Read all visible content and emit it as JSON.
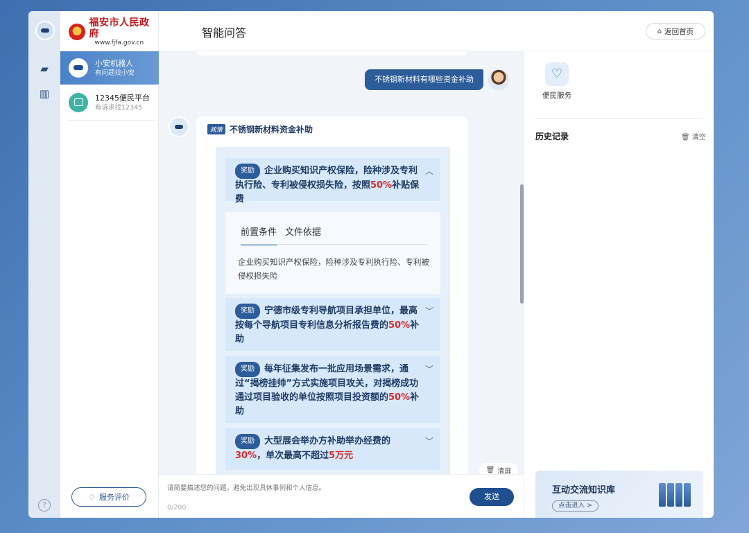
{
  "app": {
    "logo_cn": "福安市人民政府",
    "logo_url": "www.fjfa.gov.cn"
  },
  "sidebar": {
    "channels": [
      {
        "title": "小安机器人",
        "subtitle": "有问题找小安"
      },
      {
        "title": "12345便民平台",
        "subtitle": "有诉求找12345"
      }
    ],
    "rate_button": "服务评价",
    "help_symbol": "?"
  },
  "header": {
    "title": "智能问答",
    "home_button": "返回首页"
  },
  "chat": {
    "user_question": "不锈钢新材料有哪些资金补助",
    "answer_tag": "政策",
    "answer_title": "不锈钢新材料资金补助",
    "badge": "奖励",
    "items": [
      {
        "parts": [
          "企业购买知识产权保险，险种涉及专利执行险、专利被侵权损失险，按照",
          "50%",
          "补贴保费"
        ],
        "expanded": true
      },
      {
        "parts": [
          "宁德市级专利导航项目承担单位，最高按每个导航项目专利信息分析报告费的",
          "50%",
          "补助"
        ],
        "expanded": false
      },
      {
        "parts": [
          "每年征集发布一批应用场景需求，通过“揭榜挂帅”方式实施项目攻关，对揭榜成功通过项目验收的单位按照项目投资额的",
          "50%",
          "补助"
        ],
        "expanded": false
      },
      {
        "parts": [
          "大型展会举办方补助举办经费的",
          "30%",
          "，单次最高不超过",
          "5万元"
        ],
        "expanded": false
      }
    ],
    "detail_tabs": [
      "前置条件",
      "文件依据"
    ],
    "detail_body": "企业购买知识产权保险，险种涉及专利执行险、专利被侵权损失险",
    "clear_screen": "清屏"
  },
  "input": {
    "placeholder": "请简要描述您的问题，避免出现具体事例和个人信息。",
    "counter": "0/200",
    "send": "发送"
  },
  "right_panel": {
    "service_label": "便民服务",
    "history_title": "历史记录",
    "clear_label": "清空",
    "kb_title": "互动交流知识库",
    "kb_button": "点击进入 >"
  },
  "colors": {
    "primary": "#2c5c99",
    "highlight_red": "#d92c2c",
    "panel_bg": "#e5f0fb"
  }
}
